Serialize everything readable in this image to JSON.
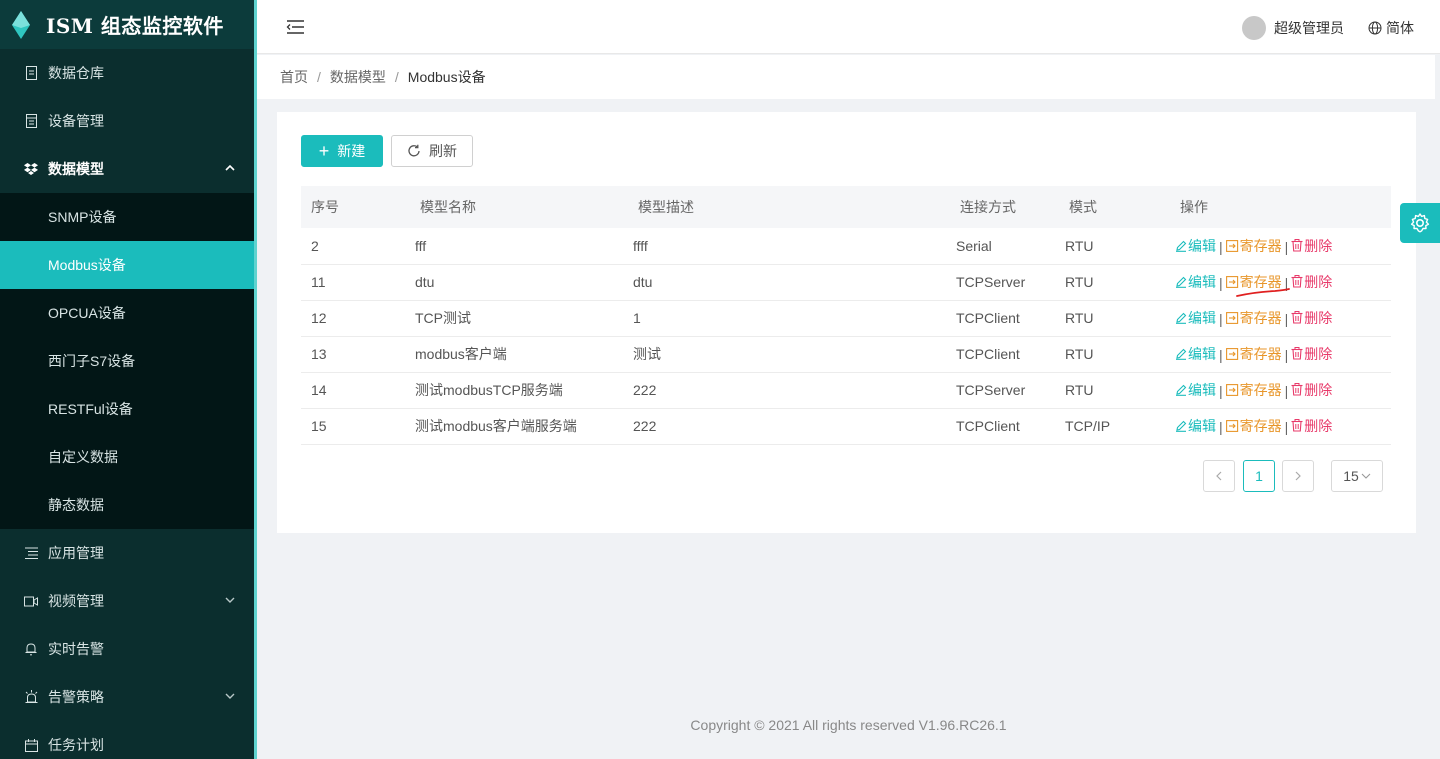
{
  "app": {
    "title": "ISM 组态监控软件"
  },
  "sidebar": {
    "items": [
      {
        "label": "数据仓库",
        "icon": "database-icon"
      },
      {
        "label": "设备管理",
        "icon": "device-icon"
      },
      {
        "label": "数据模型",
        "icon": "dropbox-icon",
        "expanded": true
      },
      {
        "label": "应用管理",
        "icon": "list-icon"
      },
      {
        "label": "视频管理",
        "icon": "video-icon",
        "has_children": true
      },
      {
        "label": "实时告警",
        "icon": "bell-icon"
      },
      {
        "label": "告警策略",
        "icon": "alarm-icon",
        "has_children": true
      },
      {
        "label": "任务计划",
        "icon": "calendar-icon"
      }
    ],
    "submenu": [
      {
        "label": "SNMP设备"
      },
      {
        "label": "Modbus设备",
        "active": true
      },
      {
        "label": "OPCUA设备"
      },
      {
        "label": "西门子S7设备"
      },
      {
        "label": "RESTFul设备"
      },
      {
        "label": "自定义数据"
      },
      {
        "label": "静态数据"
      }
    ]
  },
  "header": {
    "user": "超级管理员",
    "language": "简体"
  },
  "breadcrumb": [
    "首页",
    "数据模型",
    "Modbus设备"
  ],
  "toolbar": {
    "new_label": "新建",
    "refresh_label": "刷新"
  },
  "table": {
    "columns": [
      "序号",
      "模型名称",
      "模型描述",
      "连接方式",
      "模式",
      "操作"
    ],
    "actions": {
      "edit": "编辑",
      "register": "寄存器",
      "delete": "删除",
      "separator": "|"
    },
    "rows": [
      {
        "id": "2",
        "name": "fff",
        "desc": "ffff",
        "conn": "Serial",
        "mode": "RTU"
      },
      {
        "id": "11",
        "name": "dtu",
        "desc": "dtu",
        "conn": "TCPServer",
        "mode": "RTU"
      },
      {
        "id": "12",
        "name": "TCP测试",
        "desc": "1",
        "conn": "TCPClient",
        "mode": "RTU"
      },
      {
        "id": "13",
        "name": "modbus客户端",
        "desc": "测试",
        "conn": "TCPClient",
        "mode": "RTU"
      },
      {
        "id": "14",
        "name": "测试modbusTCP服务端",
        "desc": "222",
        "conn": "TCPServer",
        "mode": "RTU"
      },
      {
        "id": "15",
        "name": "测试modbus客户端服务端",
        "desc": "222",
        "conn": "TCPClient",
        "mode": "TCP/IP"
      }
    ]
  },
  "pagination": {
    "prev": "<",
    "current": "1",
    "next": ">",
    "page_size": "15"
  },
  "footer": {
    "copyright": "Copyright © 2021 All rights reserved V1.96.RC26.1"
  },
  "colors": {
    "accent": "#1bbcbc",
    "sidebar_bg": "#0b2e2e",
    "submenu_bg": "#021616",
    "edit": "#1bbcbc",
    "register": "#e8962a",
    "delete": "#e83a6a",
    "annotation": "#e02020"
  }
}
